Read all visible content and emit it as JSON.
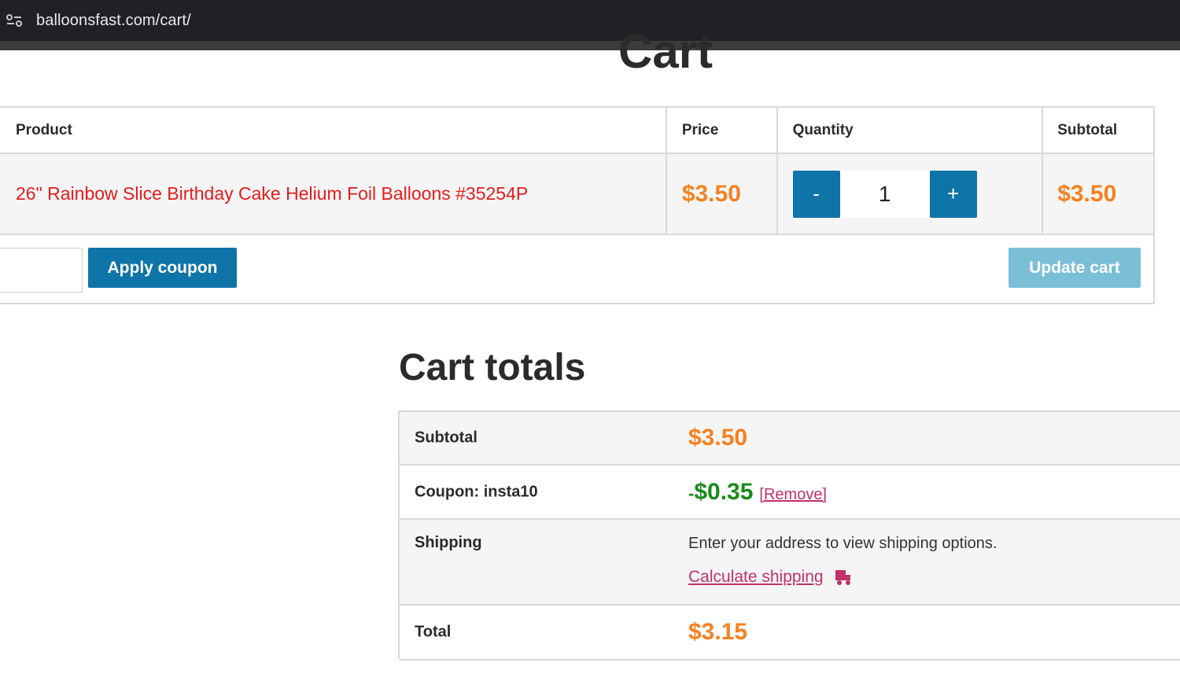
{
  "browser": {
    "url": "balloonsfast.com/cart/"
  },
  "page": {
    "title": "Cart"
  },
  "cart_table": {
    "headers": {
      "product": "Product",
      "price": "Price",
      "quantity": "Quantity",
      "subtotal": "Subtotal"
    },
    "item": {
      "product": "26\" Rainbow Slice Birthday Cake Helium Foil Balloons #35254P",
      "price": "$3.50",
      "quantity": "1",
      "subtotal": "$3.50",
      "minus_label": "-",
      "plus_label": "+"
    },
    "actions": {
      "apply_coupon": "Apply coupon",
      "update_cart": "Update cart"
    }
  },
  "totals": {
    "title": "Cart totals",
    "subtotal_label": "Subtotal",
    "subtotal_value": "$3.50",
    "coupon_label": "Coupon: insta10",
    "coupon_dash": "-",
    "coupon_value": "$0.35",
    "remove_label": "[Remove]",
    "shipping_label": "Shipping",
    "shipping_text": "Enter your address to view shipping options.",
    "calc_shipping": "Calculate shipping",
    "total_label": "Total",
    "total_value": "$3.15"
  },
  "colors": {
    "accent_blue": "#0f74a8",
    "price_orange": "#f5811f",
    "link_red": "#e61c1c",
    "discount_green": "#1a8a1a",
    "link_pink": "#c0316d"
  }
}
